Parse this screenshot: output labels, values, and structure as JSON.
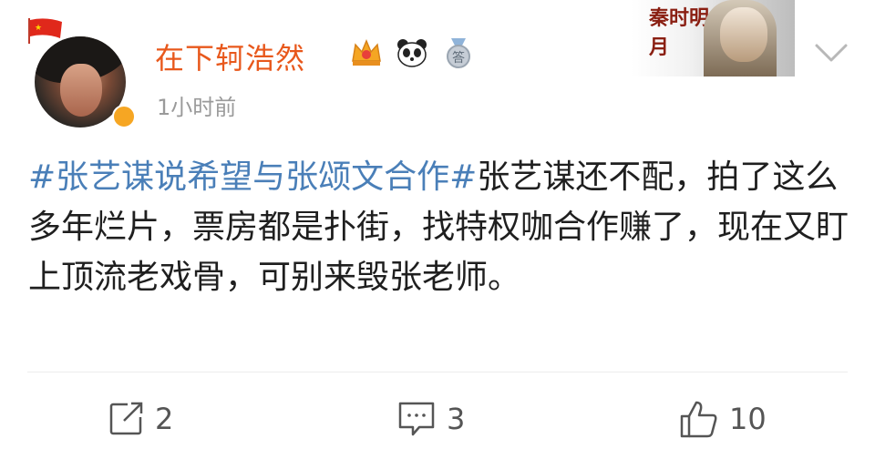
{
  "user": {
    "name": "在下轲浩然",
    "time": "1小时前",
    "badges": [
      "crown-icon",
      "panda-icon",
      "medal-icon"
    ],
    "medal_text": "答"
  },
  "post": {
    "hashtag": "#张艺谋说希望与张颂文合作#",
    "text": "张艺谋还不配，拍了这么多年烂片，票房都是扑街，找特权咖合作赚了，现在又盯上顶流老戏骨，可别来毁张老师。"
  },
  "actions": {
    "repost_count": "2",
    "comment_count": "3",
    "like_count": "10"
  },
  "card": {
    "brush_text": "秦时明月"
  },
  "colors": {
    "username": "#e8581c",
    "hashtag": "#4a7fb8",
    "meta": "#9a9a9a"
  }
}
